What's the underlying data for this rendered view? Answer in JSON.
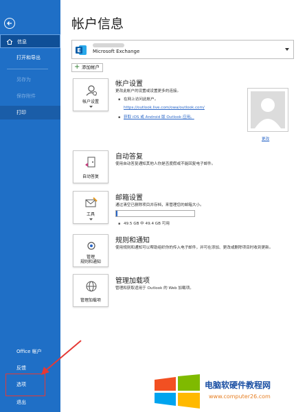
{
  "sidebar": {
    "items": {
      "info": "信息",
      "open_export": "打开和导出",
      "save_as": "另存为",
      "save_attachments": "保存附件",
      "print": "打印",
      "office_account": "Office 帐户",
      "feedback": "反馈",
      "options": "选项",
      "exit": "退出"
    }
  },
  "main": {
    "title": "帐户信息",
    "account_name": "Microsoft Exchange",
    "add_account": "添加帐户",
    "account_settings": {
      "button": "帐户设置",
      "title": "帐户设置",
      "desc": "更改此帐户的设置或设置更多的连接。",
      "bullet": "在网上访问此帐户。",
      "owa_link": "https://outlook.live.com/owa/outlook.com/",
      "mobile_link": "获取 iOS 或 Android 版 Outlook 应用。",
      "change": "更改"
    },
    "auto_reply": {
      "button": "自动答复",
      "title": "自动答复",
      "desc": "使用自动答复通知其他人你是否度假或不能回复电子邮件。"
    },
    "mailbox": {
      "button": "工具",
      "title": "邮箱设置",
      "desc": "通过清空已删除项目并存档，来管理您的邮箱大小。",
      "usage_text": "49.5 GB 中 49.4 GB 可用",
      "usage_fraction": 0.02
    },
    "rules": {
      "button_line1": "管理",
      "button_line2": "规则和通知",
      "title": "规则和通知",
      "desc": "使用规则和通知可以帮助组织你的传入电子邮件，并可在添加、更改或删除项目时收到更新。"
    },
    "addins": {
      "button": "管理加载项",
      "title": "管理加载项",
      "desc": "管理和获取适用于 Outlook 的 Web 加载项。"
    }
  },
  "watermark": {
    "text": "电脑软硬件教程网",
    "url": "www.computer26.com"
  },
  "colors": {
    "sidebar": "#1f6fc6",
    "accent": "#2a67c8",
    "highlight": "#e53935"
  }
}
